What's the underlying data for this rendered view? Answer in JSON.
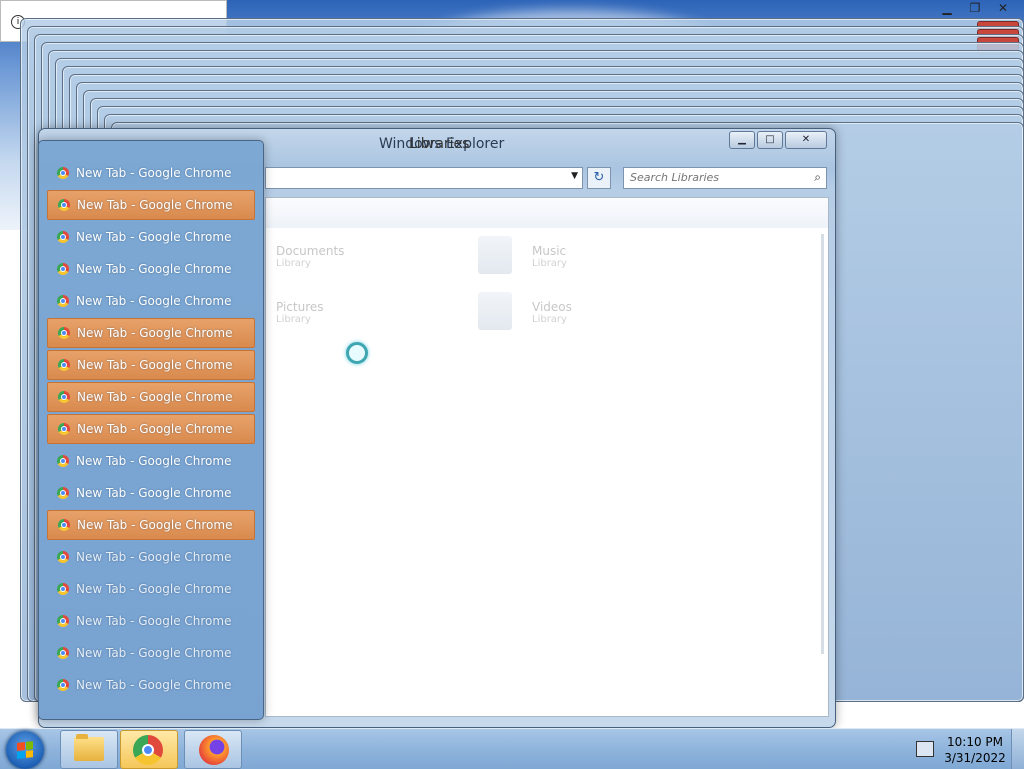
{
  "explorer": {
    "title_back": "Windows Explorer",
    "title_front": "Libraries",
    "search_placeholder": "Search Libraries",
    "libraries": [
      {
        "name": "Documents",
        "sub": "Library"
      },
      {
        "name": "Music",
        "sub": "Library"
      },
      {
        "name": "Pictures",
        "sub": "Library"
      },
      {
        "name": "Videos",
        "sub": "Library"
      }
    ]
  },
  "tab_list": {
    "items": [
      {
        "label": "New Tab - Google Chrome",
        "active": false
      },
      {
        "label": "New Tab - Google Chrome",
        "active": true
      },
      {
        "label": "New Tab - Google Chrome",
        "active": false
      },
      {
        "label": "New Tab - Google Chrome",
        "active": false
      },
      {
        "label": "New Tab - Google Chrome",
        "active": false
      },
      {
        "label": "New Tab - Google Chrome",
        "active": true
      },
      {
        "label": "New Tab - Google Chrome",
        "active": true
      },
      {
        "label": "New Tab - Google Chrome",
        "active": true
      },
      {
        "label": "New Tab - Google Chrome",
        "active": true
      },
      {
        "label": "New Tab - Google Chrome",
        "active": false
      },
      {
        "label": "New Tab - Google Chrome",
        "active": false
      },
      {
        "label": "New Tab - Google Chrome",
        "active": true
      },
      {
        "label": "New Tab - Google Chrome",
        "active": false
      },
      {
        "label": "New Tab - Google Chrome",
        "active": false
      },
      {
        "label": "New Tab - Google Chrome",
        "active": false
      },
      {
        "label": "New Tab - Google Chrome",
        "active": false
      },
      {
        "label": "New Tab - Google Chrome",
        "active": false
      }
    ]
  },
  "taskbar": {
    "time": "10:10 PM",
    "date": "3/31/2022",
    "apps": [
      "windows-explorer",
      "google-chrome",
      "firefox"
    ]
  },
  "colors": {
    "tab_active": "#d98a4e",
    "taskbar": "#8fb4dc",
    "tab_panel": "#78a5d2"
  }
}
